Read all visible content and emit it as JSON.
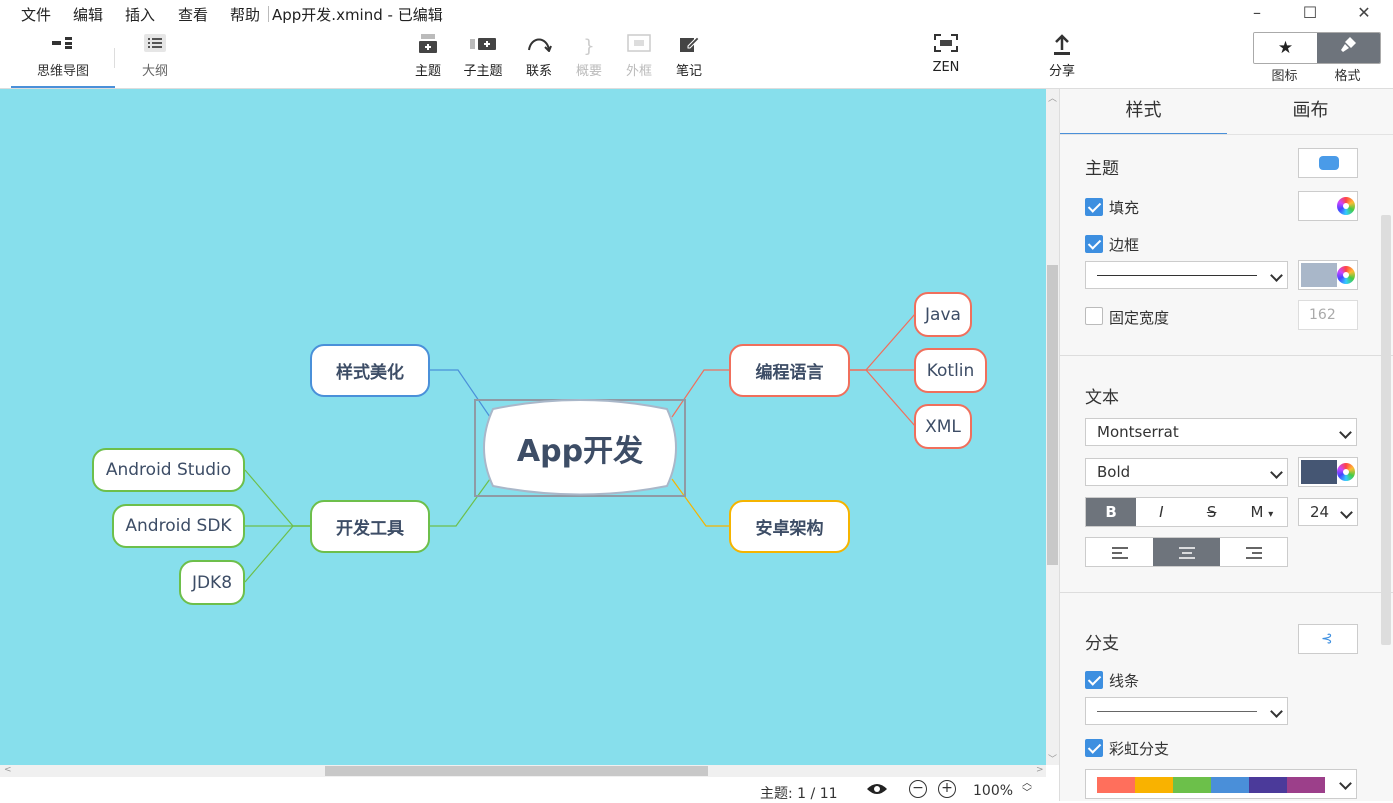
{
  "menubar": {
    "items": [
      "文件",
      "编辑",
      "插入",
      "查看",
      "帮助"
    ],
    "document_title": "App开发.xmind - 已编辑",
    "window_controls": [
      "minimize-icon",
      "maximize-icon",
      "close-icon"
    ]
  },
  "toolbar": {
    "view_tabs": [
      {
        "label": "思维导图",
        "icon": "mindmap-icon",
        "active": true
      },
      {
        "label": "大纲",
        "icon": "outline-icon",
        "active": false
      }
    ],
    "insert_buttons": [
      {
        "label": "主题",
        "icon": "topic-icon",
        "enabled": true
      },
      {
        "label": "子主题",
        "icon": "subtopic-icon",
        "enabled": true
      },
      {
        "label": "联系",
        "icon": "relationship-icon",
        "enabled": true
      },
      {
        "label": "概要",
        "icon": "summary-icon",
        "enabled": false
      },
      {
        "label": "外框",
        "icon": "boundary-icon",
        "enabled": false
      },
      {
        "label": "笔记",
        "icon": "notes-icon",
        "enabled": true
      }
    ],
    "zen_label": "ZEN",
    "share_label": "分享",
    "panel_toggle": [
      {
        "label": "图标",
        "icon": "star-icon",
        "active": false
      },
      {
        "label": "格式",
        "icon": "brush-icon",
        "active": true
      }
    ]
  },
  "mindmap": {
    "central": {
      "label": "App开发"
    },
    "branches": [
      {
        "label": "样式美化",
        "color": "#4a90d9",
        "children": []
      },
      {
        "label": "开发工具",
        "color": "#6dbf4b",
        "children": [
          "Android Studio",
          "Android SDK",
          "JDK8"
        ]
      },
      {
        "label": "编程语言",
        "color": "#f06f5c",
        "children": [
          "Java",
          "Kotlin",
          "XML"
        ]
      },
      {
        "label": "安卓架构",
        "color": "#f5b400",
        "children": []
      }
    ],
    "background_color": "#87dfec"
  },
  "statusbar": {
    "topic_count": "主题: 1 / 11",
    "zoom": "100%",
    "eye_icon": "eye-icon",
    "zoom_out_icon": "zoom-out-icon",
    "zoom_in_icon": "zoom-in-icon"
  },
  "panel": {
    "tabs": [
      "样式",
      "画布"
    ],
    "active_tab": "样式",
    "topic": {
      "title": "主题",
      "fill_label": "填充",
      "fill_checked": true,
      "fill_color": "#ffffff",
      "border_label": "边框",
      "border_checked": true,
      "border_color": "#a9b7c9",
      "fixed_width_label": "固定宽度",
      "fixed_width_checked": false,
      "fixed_width_value": "162"
    },
    "text": {
      "title": "文本",
      "font": "Montserrat",
      "weight": "Bold",
      "text_color": "#455673",
      "style_buttons": [
        "B",
        "I",
        "S",
        "M"
      ],
      "size": "24",
      "align": [
        "left",
        "center",
        "right"
      ],
      "align_active": "center"
    },
    "branch": {
      "title": "分支",
      "line_label": "线条",
      "line_checked": true,
      "rainbow_label": "彩虹分支",
      "rainbow_checked": true,
      "rainbow_colors": [
        "#ff6f5c",
        "#f9b200",
        "#6cc04a",
        "#4a8fd9",
        "#4b3a9a",
        "#9c3f8a"
      ]
    }
  }
}
